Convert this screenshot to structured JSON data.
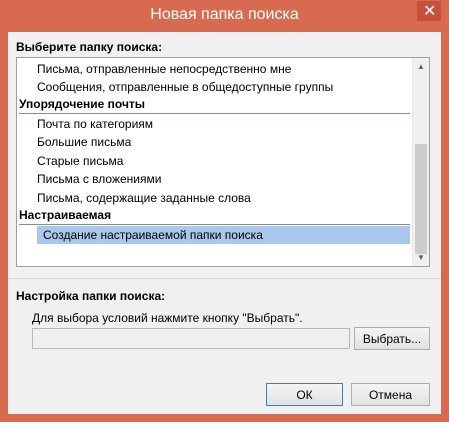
{
  "window": {
    "title": "Новая папка поиска",
    "close_glyph": "✕",
    "accent": "#d86a50"
  },
  "select_label": "Выберите папку поиска:",
  "list": {
    "rows": [
      {
        "kind": "item",
        "text": "Письма, отправленные непосредственно мне"
      },
      {
        "kind": "item",
        "text": "Сообщения, отправленные в общедоступные группы"
      },
      {
        "kind": "group",
        "text": "Упорядочение почты"
      },
      {
        "kind": "item",
        "text": "Почта по категориям"
      },
      {
        "kind": "item",
        "text": "Большие письма"
      },
      {
        "kind": "item",
        "text": "Старые письма"
      },
      {
        "kind": "item",
        "text": "Письма с вложениями"
      },
      {
        "kind": "item",
        "text": "Письма, содержащие заданные слова"
      },
      {
        "kind": "group",
        "text": "Настраиваемая"
      },
      {
        "kind": "selected",
        "text": "Создание настраиваемой папки поиска"
      }
    ],
    "scroll_up_glyph": "▲",
    "scroll_down_glyph": "▼"
  },
  "settings": {
    "label": "Настройка папки поиска:",
    "hint": "Для выбора условий нажмите кнопку \"Выбрать\".",
    "criteria_value": "",
    "browse_label": "Выбрать..."
  },
  "buttons": {
    "ok": "ОК",
    "cancel": "Отмена"
  }
}
